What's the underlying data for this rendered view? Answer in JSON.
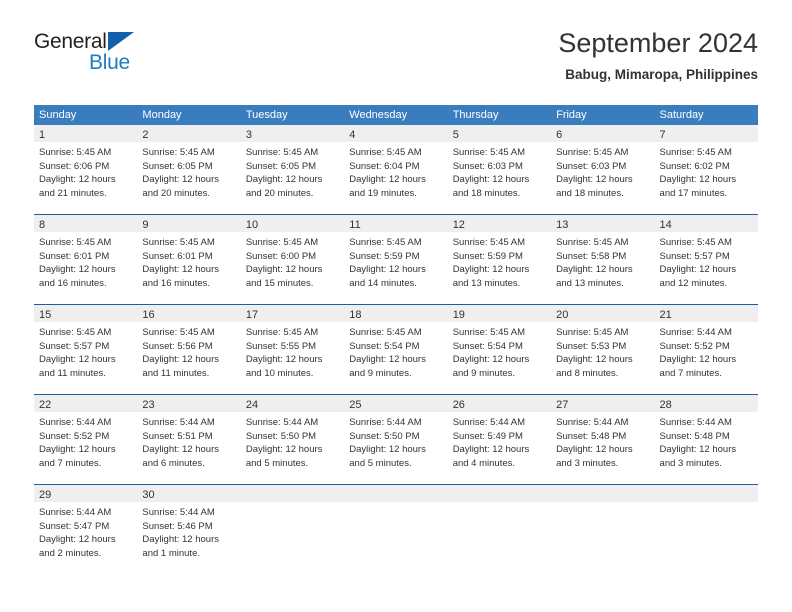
{
  "brand": {
    "name_top": "General",
    "name_bottom": "Blue",
    "color_dark": "#231f20",
    "color_blue": "#1d7cc4",
    "triangle_color": "#1461ab"
  },
  "header": {
    "title": "September 2024",
    "subtitle": "Babug, Mimaropa, Philippines"
  },
  "theme": {
    "header_bg": "#3a7dbf",
    "header_text": "#ffffff",
    "row_divider": "#1a5fa0",
    "date_band_bg": "#efefef",
    "cell_bg": "#ffffff",
    "text": "#333333"
  },
  "weekdays": [
    "Sunday",
    "Monday",
    "Tuesday",
    "Wednesday",
    "Thursday",
    "Friday",
    "Saturday"
  ],
  "weeks": [
    [
      {
        "day": "1",
        "sunrise": "Sunrise: 5:45 AM",
        "sunset": "Sunset: 6:06 PM",
        "daylight1": "Daylight: 12 hours",
        "daylight2": "and 21 minutes."
      },
      {
        "day": "2",
        "sunrise": "Sunrise: 5:45 AM",
        "sunset": "Sunset: 6:05 PM",
        "daylight1": "Daylight: 12 hours",
        "daylight2": "and 20 minutes."
      },
      {
        "day": "3",
        "sunrise": "Sunrise: 5:45 AM",
        "sunset": "Sunset: 6:05 PM",
        "daylight1": "Daylight: 12 hours",
        "daylight2": "and 20 minutes."
      },
      {
        "day": "4",
        "sunrise": "Sunrise: 5:45 AM",
        "sunset": "Sunset: 6:04 PM",
        "daylight1": "Daylight: 12 hours",
        "daylight2": "and 19 minutes."
      },
      {
        "day": "5",
        "sunrise": "Sunrise: 5:45 AM",
        "sunset": "Sunset: 6:03 PM",
        "daylight1": "Daylight: 12 hours",
        "daylight2": "and 18 minutes."
      },
      {
        "day": "6",
        "sunrise": "Sunrise: 5:45 AM",
        "sunset": "Sunset: 6:03 PM",
        "daylight1": "Daylight: 12 hours",
        "daylight2": "and 18 minutes."
      },
      {
        "day": "7",
        "sunrise": "Sunrise: 5:45 AM",
        "sunset": "Sunset: 6:02 PM",
        "daylight1": "Daylight: 12 hours",
        "daylight2": "and 17 minutes."
      }
    ],
    [
      {
        "day": "8",
        "sunrise": "Sunrise: 5:45 AM",
        "sunset": "Sunset: 6:01 PM",
        "daylight1": "Daylight: 12 hours",
        "daylight2": "and 16 minutes."
      },
      {
        "day": "9",
        "sunrise": "Sunrise: 5:45 AM",
        "sunset": "Sunset: 6:01 PM",
        "daylight1": "Daylight: 12 hours",
        "daylight2": "and 16 minutes."
      },
      {
        "day": "10",
        "sunrise": "Sunrise: 5:45 AM",
        "sunset": "Sunset: 6:00 PM",
        "daylight1": "Daylight: 12 hours",
        "daylight2": "and 15 minutes."
      },
      {
        "day": "11",
        "sunrise": "Sunrise: 5:45 AM",
        "sunset": "Sunset: 5:59 PM",
        "daylight1": "Daylight: 12 hours",
        "daylight2": "and 14 minutes."
      },
      {
        "day": "12",
        "sunrise": "Sunrise: 5:45 AM",
        "sunset": "Sunset: 5:59 PM",
        "daylight1": "Daylight: 12 hours",
        "daylight2": "and 13 minutes."
      },
      {
        "day": "13",
        "sunrise": "Sunrise: 5:45 AM",
        "sunset": "Sunset: 5:58 PM",
        "daylight1": "Daylight: 12 hours",
        "daylight2": "and 13 minutes."
      },
      {
        "day": "14",
        "sunrise": "Sunrise: 5:45 AM",
        "sunset": "Sunset: 5:57 PM",
        "daylight1": "Daylight: 12 hours",
        "daylight2": "and 12 minutes."
      }
    ],
    [
      {
        "day": "15",
        "sunrise": "Sunrise: 5:45 AM",
        "sunset": "Sunset: 5:57 PM",
        "daylight1": "Daylight: 12 hours",
        "daylight2": "and 11 minutes."
      },
      {
        "day": "16",
        "sunrise": "Sunrise: 5:45 AM",
        "sunset": "Sunset: 5:56 PM",
        "daylight1": "Daylight: 12 hours",
        "daylight2": "and 11 minutes."
      },
      {
        "day": "17",
        "sunrise": "Sunrise: 5:45 AM",
        "sunset": "Sunset: 5:55 PM",
        "daylight1": "Daylight: 12 hours",
        "daylight2": "and 10 minutes."
      },
      {
        "day": "18",
        "sunrise": "Sunrise: 5:45 AM",
        "sunset": "Sunset: 5:54 PM",
        "daylight1": "Daylight: 12 hours",
        "daylight2": "and 9 minutes."
      },
      {
        "day": "19",
        "sunrise": "Sunrise: 5:45 AM",
        "sunset": "Sunset: 5:54 PM",
        "daylight1": "Daylight: 12 hours",
        "daylight2": "and 9 minutes."
      },
      {
        "day": "20",
        "sunrise": "Sunrise: 5:45 AM",
        "sunset": "Sunset: 5:53 PM",
        "daylight1": "Daylight: 12 hours",
        "daylight2": "and 8 minutes."
      },
      {
        "day": "21",
        "sunrise": "Sunrise: 5:44 AM",
        "sunset": "Sunset: 5:52 PM",
        "daylight1": "Daylight: 12 hours",
        "daylight2": "and 7 minutes."
      }
    ],
    [
      {
        "day": "22",
        "sunrise": "Sunrise: 5:44 AM",
        "sunset": "Sunset: 5:52 PM",
        "daylight1": "Daylight: 12 hours",
        "daylight2": "and 7 minutes."
      },
      {
        "day": "23",
        "sunrise": "Sunrise: 5:44 AM",
        "sunset": "Sunset: 5:51 PM",
        "daylight1": "Daylight: 12 hours",
        "daylight2": "and 6 minutes."
      },
      {
        "day": "24",
        "sunrise": "Sunrise: 5:44 AM",
        "sunset": "Sunset: 5:50 PM",
        "daylight1": "Daylight: 12 hours",
        "daylight2": "and 5 minutes."
      },
      {
        "day": "25",
        "sunrise": "Sunrise: 5:44 AM",
        "sunset": "Sunset: 5:50 PM",
        "daylight1": "Daylight: 12 hours",
        "daylight2": "and 5 minutes."
      },
      {
        "day": "26",
        "sunrise": "Sunrise: 5:44 AM",
        "sunset": "Sunset: 5:49 PM",
        "daylight1": "Daylight: 12 hours",
        "daylight2": "and 4 minutes."
      },
      {
        "day": "27",
        "sunrise": "Sunrise: 5:44 AM",
        "sunset": "Sunset: 5:48 PM",
        "daylight1": "Daylight: 12 hours",
        "daylight2": "and 3 minutes."
      },
      {
        "day": "28",
        "sunrise": "Sunrise: 5:44 AM",
        "sunset": "Sunset: 5:48 PM",
        "daylight1": "Daylight: 12 hours",
        "daylight2": "and 3 minutes."
      }
    ],
    [
      {
        "day": "29",
        "sunrise": "Sunrise: 5:44 AM",
        "sunset": "Sunset: 5:47 PM",
        "daylight1": "Daylight: 12 hours",
        "daylight2": "and 2 minutes."
      },
      {
        "day": "30",
        "sunrise": "Sunrise: 5:44 AM",
        "sunset": "Sunset: 5:46 PM",
        "daylight1": "Daylight: 12 hours",
        "daylight2": "and 1 minute."
      },
      {
        "day": "",
        "sunrise": "",
        "sunset": "",
        "daylight1": "",
        "daylight2": ""
      },
      {
        "day": "",
        "sunrise": "",
        "sunset": "",
        "daylight1": "",
        "daylight2": ""
      },
      {
        "day": "",
        "sunrise": "",
        "sunset": "",
        "daylight1": "",
        "daylight2": ""
      },
      {
        "day": "",
        "sunrise": "",
        "sunset": "",
        "daylight1": "",
        "daylight2": ""
      },
      {
        "day": "",
        "sunrise": "",
        "sunset": "",
        "daylight1": "",
        "daylight2": ""
      }
    ]
  ]
}
